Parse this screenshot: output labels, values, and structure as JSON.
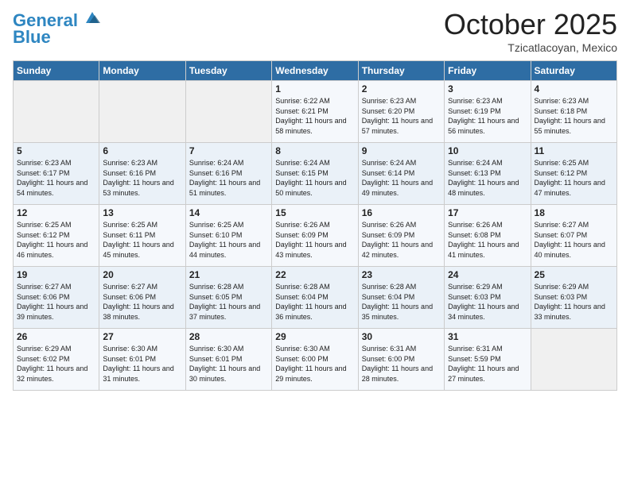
{
  "header": {
    "logo_line1": "General",
    "logo_line2": "Blue",
    "month": "October 2025",
    "location": "Tzicatlacoyan, Mexico"
  },
  "weekdays": [
    "Sunday",
    "Monday",
    "Tuesday",
    "Wednesday",
    "Thursday",
    "Friday",
    "Saturday"
  ],
  "weeks": [
    [
      {
        "day": "",
        "info": ""
      },
      {
        "day": "",
        "info": ""
      },
      {
        "day": "",
        "info": ""
      },
      {
        "day": "1",
        "info": "Sunrise: 6:22 AM\nSunset: 6:21 PM\nDaylight: 11 hours and 58 minutes."
      },
      {
        "day": "2",
        "info": "Sunrise: 6:23 AM\nSunset: 6:20 PM\nDaylight: 11 hours and 57 minutes."
      },
      {
        "day": "3",
        "info": "Sunrise: 6:23 AM\nSunset: 6:19 PM\nDaylight: 11 hours and 56 minutes."
      },
      {
        "day": "4",
        "info": "Sunrise: 6:23 AM\nSunset: 6:18 PM\nDaylight: 11 hours and 55 minutes."
      }
    ],
    [
      {
        "day": "5",
        "info": "Sunrise: 6:23 AM\nSunset: 6:17 PM\nDaylight: 11 hours and 54 minutes."
      },
      {
        "day": "6",
        "info": "Sunrise: 6:23 AM\nSunset: 6:16 PM\nDaylight: 11 hours and 53 minutes."
      },
      {
        "day": "7",
        "info": "Sunrise: 6:24 AM\nSunset: 6:16 PM\nDaylight: 11 hours and 51 minutes."
      },
      {
        "day": "8",
        "info": "Sunrise: 6:24 AM\nSunset: 6:15 PM\nDaylight: 11 hours and 50 minutes."
      },
      {
        "day": "9",
        "info": "Sunrise: 6:24 AM\nSunset: 6:14 PM\nDaylight: 11 hours and 49 minutes."
      },
      {
        "day": "10",
        "info": "Sunrise: 6:24 AM\nSunset: 6:13 PM\nDaylight: 11 hours and 48 minutes."
      },
      {
        "day": "11",
        "info": "Sunrise: 6:25 AM\nSunset: 6:12 PM\nDaylight: 11 hours and 47 minutes."
      }
    ],
    [
      {
        "day": "12",
        "info": "Sunrise: 6:25 AM\nSunset: 6:12 PM\nDaylight: 11 hours and 46 minutes."
      },
      {
        "day": "13",
        "info": "Sunrise: 6:25 AM\nSunset: 6:11 PM\nDaylight: 11 hours and 45 minutes."
      },
      {
        "day": "14",
        "info": "Sunrise: 6:25 AM\nSunset: 6:10 PM\nDaylight: 11 hours and 44 minutes."
      },
      {
        "day": "15",
        "info": "Sunrise: 6:26 AM\nSunset: 6:09 PM\nDaylight: 11 hours and 43 minutes."
      },
      {
        "day": "16",
        "info": "Sunrise: 6:26 AM\nSunset: 6:09 PM\nDaylight: 11 hours and 42 minutes."
      },
      {
        "day": "17",
        "info": "Sunrise: 6:26 AM\nSunset: 6:08 PM\nDaylight: 11 hours and 41 minutes."
      },
      {
        "day": "18",
        "info": "Sunrise: 6:27 AM\nSunset: 6:07 PM\nDaylight: 11 hours and 40 minutes."
      }
    ],
    [
      {
        "day": "19",
        "info": "Sunrise: 6:27 AM\nSunset: 6:06 PM\nDaylight: 11 hours and 39 minutes."
      },
      {
        "day": "20",
        "info": "Sunrise: 6:27 AM\nSunset: 6:06 PM\nDaylight: 11 hours and 38 minutes."
      },
      {
        "day": "21",
        "info": "Sunrise: 6:28 AM\nSunset: 6:05 PM\nDaylight: 11 hours and 37 minutes."
      },
      {
        "day": "22",
        "info": "Sunrise: 6:28 AM\nSunset: 6:04 PM\nDaylight: 11 hours and 36 minutes."
      },
      {
        "day": "23",
        "info": "Sunrise: 6:28 AM\nSunset: 6:04 PM\nDaylight: 11 hours and 35 minutes."
      },
      {
        "day": "24",
        "info": "Sunrise: 6:29 AM\nSunset: 6:03 PM\nDaylight: 11 hours and 34 minutes."
      },
      {
        "day": "25",
        "info": "Sunrise: 6:29 AM\nSunset: 6:03 PM\nDaylight: 11 hours and 33 minutes."
      }
    ],
    [
      {
        "day": "26",
        "info": "Sunrise: 6:29 AM\nSunset: 6:02 PM\nDaylight: 11 hours and 32 minutes."
      },
      {
        "day": "27",
        "info": "Sunrise: 6:30 AM\nSunset: 6:01 PM\nDaylight: 11 hours and 31 minutes."
      },
      {
        "day": "28",
        "info": "Sunrise: 6:30 AM\nSunset: 6:01 PM\nDaylight: 11 hours and 30 minutes."
      },
      {
        "day": "29",
        "info": "Sunrise: 6:30 AM\nSunset: 6:00 PM\nDaylight: 11 hours and 29 minutes."
      },
      {
        "day": "30",
        "info": "Sunrise: 6:31 AM\nSunset: 6:00 PM\nDaylight: 11 hours and 28 minutes."
      },
      {
        "day": "31",
        "info": "Sunrise: 6:31 AM\nSunset: 5:59 PM\nDaylight: 11 hours and 27 minutes."
      },
      {
        "day": "",
        "info": ""
      }
    ]
  ]
}
